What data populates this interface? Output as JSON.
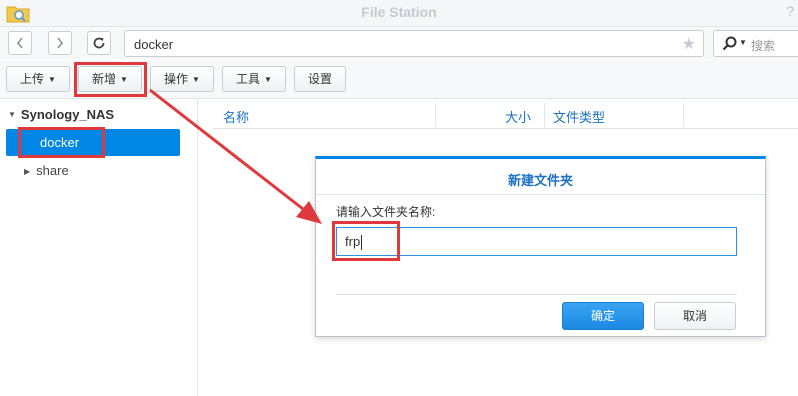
{
  "window": {
    "title": "File Station",
    "help_icon": "help-icon"
  },
  "navigation": {
    "back_icon": "chevron-left-icon",
    "forward_icon": "chevron-right-icon",
    "refresh_icon": "refresh-icon",
    "path": "docker",
    "favorite_icon": "star-icon",
    "search_placeholder": "搜索"
  },
  "toolbar": {
    "upload": "上传",
    "create": "新增",
    "action": "操作",
    "tools": "工具",
    "settings": "设置"
  },
  "sidebar": {
    "root": "Synology_NAS",
    "items": [
      {
        "label": "docker",
        "selected": true
      },
      {
        "label": "share",
        "selected": false
      }
    ]
  },
  "file_list": {
    "columns": [
      "名称",
      "大小",
      "文件类型"
    ]
  },
  "dialog": {
    "title": "新建文件夹",
    "prompt": "请输入文件夹名称:",
    "input_value": "frp",
    "ok_label": "确定",
    "cancel_label": "取消"
  },
  "colors": {
    "accent": "#0086e5",
    "highlight": "#e0393d",
    "header_text": "#1c71c4"
  }
}
